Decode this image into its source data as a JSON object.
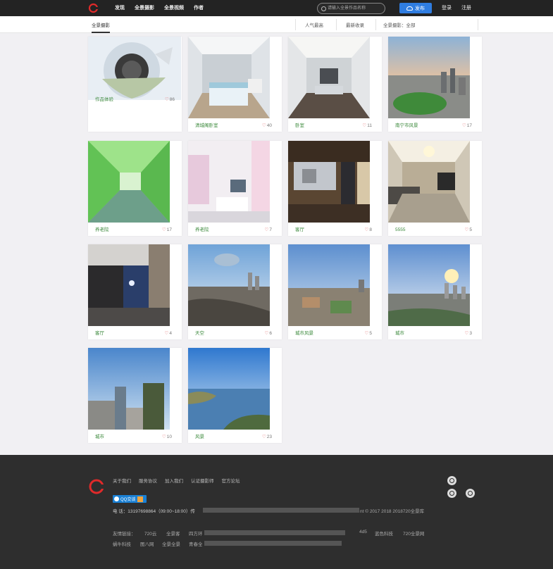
{
  "header": {
    "nav": [
      "发现",
      "全景摄影",
      "全景视频",
      "作者"
    ],
    "search_placeholder": "请输入全景作品名称",
    "publish_label": "发布",
    "login_label": "登录",
    "register_label": "注册"
  },
  "subheader": {
    "active_tab": "全景摄影",
    "filters": [
      "人气最高",
      "最新收录",
      "全景摄影：全部"
    ]
  },
  "works": [
    {
      "title": "作品体验",
      "likes": "86"
    },
    {
      "title": "清城阁卧室",
      "likes": "40"
    },
    {
      "title": "卧室",
      "likes": "11"
    },
    {
      "title": "南宁市风景",
      "likes": "17"
    },
    {
      "title": "养老院",
      "likes": "17"
    },
    {
      "title": "养老院",
      "likes": "7"
    },
    {
      "title": "客厅",
      "likes": "8"
    },
    {
      "title": "5555",
      "likes": "5"
    },
    {
      "title": "客厅",
      "likes": "4"
    },
    {
      "title": "天空",
      "likes": "6"
    },
    {
      "title": "城市风景",
      "likes": "5"
    },
    {
      "title": "城市",
      "likes": "3"
    },
    {
      "title": "城市",
      "likes": "10"
    },
    {
      "title": "风景",
      "likes": "23"
    }
  ],
  "footer": {
    "links": [
      "关于我们",
      "服务协议",
      "加入我们",
      "认证摄影师",
      "官方论坛"
    ],
    "qq_label": "QQ交谈",
    "phone": "电 话：13197698864（09:00~18:00）传",
    "copyright": "nt © 2017 2018 2018720全景库",
    "friend_label": "友情链接：",
    "friends_row1": [
      "720云",
      "全景客",
      "四方环",
      "4d5",
      "蓝色科技",
      "720全景网"
    ],
    "friends_row2": [
      "蜗牛科技",
      "图八网",
      "全景全景",
      "青春全"
    ]
  },
  "colors": {
    "accent": "#2f7de1",
    "title_green": "#3c8a3c",
    "heart_red": "#e06060",
    "logo_red": "#e02a2a"
  }
}
